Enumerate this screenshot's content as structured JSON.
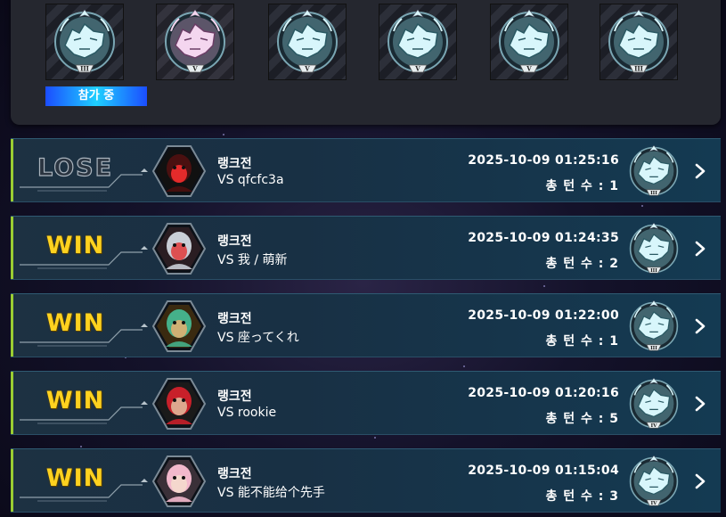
{
  "rank_history": {
    "badges": [
      {
        "icon": "wolf-rank-badge-icon",
        "tier": "III",
        "color": "#8fd3e0"
      },
      {
        "icon": "bear-rank-badge-icon",
        "tier": "V",
        "color": "#d9a6cf"
      },
      {
        "icon": "wolf-rank-badge-icon",
        "tier": "V",
        "color": "#8fd3e0"
      },
      {
        "icon": "wolf-rank-badge-icon",
        "tier": "V",
        "color": "#8fd3e0"
      },
      {
        "icon": "wolf-rank-badge-icon",
        "tier": "V",
        "color": "#8fd3e0"
      },
      {
        "icon": "wolf-rank-badge-icon",
        "tier": "III",
        "color": "#8fd3e0"
      }
    ],
    "status_label": "참가 중"
  },
  "matches": [
    {
      "result": "LOSE",
      "mode": "랭크전",
      "opponent": "VS  qfcfc3a",
      "datetime": "2025-10-09 01:25:16",
      "turns": "총 턴 수 : 1",
      "rank_tier": "III",
      "avatar": "dark-monster-avatar-icon"
    },
    {
      "result": "WIN",
      "mode": "랭크전",
      "opponent": "VS  我 / 萌新",
      "datetime": "2025-10-09 01:24:35",
      "turns": "총 턴 수 : 2",
      "rank_tier": "III",
      "avatar": "robot-avatar-icon"
    },
    {
      "result": "WIN",
      "mode": "랭크전",
      "opponent": "VS  座ってくれ",
      "datetime": "2025-10-09 01:22:00",
      "turns": "총 턴 수 : 1",
      "rank_tier": "III",
      "avatar": "green-hair-duelist-avatar-icon"
    },
    {
      "result": "WIN",
      "mode": "랭크전",
      "opponent": "VS  rookie",
      "datetime": "2025-10-09 01:20:16",
      "turns": "총 턴 수 : 5",
      "rank_tier": "IV",
      "avatar": "red-cap-duelist-avatar-icon"
    },
    {
      "result": "WIN",
      "mode": "랭크전",
      "opponent": "VS  能不能给个先手",
      "datetime": "2025-10-09 01:15:04",
      "turns": "총 턴 수 : 3",
      "rank_tier": "IV",
      "avatar": "pink-hair-girl-avatar-icon"
    }
  ],
  "colors": {
    "win": "#ffd21f",
    "lose": "#aab4bd",
    "accent_bar": "#9acd32",
    "row_bg": "#183044"
  }
}
